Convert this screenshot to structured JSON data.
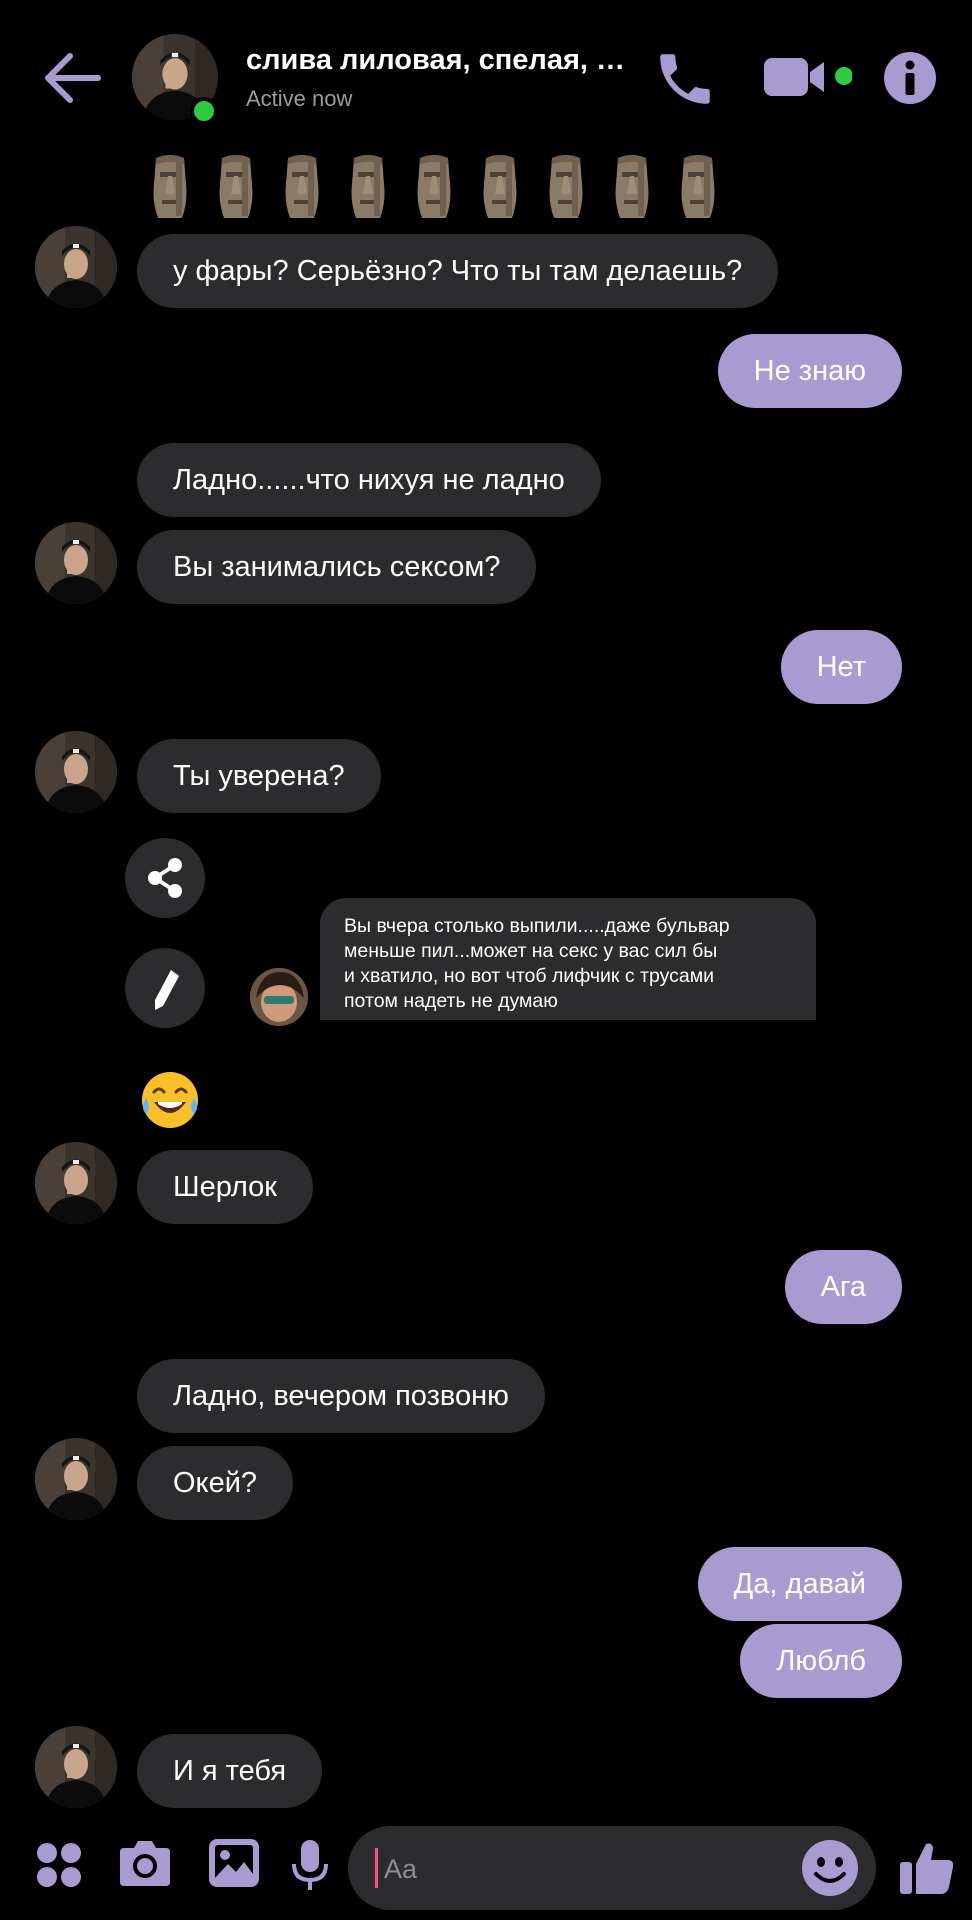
{
  "header": {
    "contact_name": "слива лиловая, спелая, с...",
    "status": "Active now"
  },
  "reaction_row": {
    "emoji": "moai",
    "count": 9
  },
  "messages": [
    {
      "side": "in",
      "text": "у фары? Серьёзно? Что ты там делаешь?"
    },
    {
      "side": "out",
      "text": "Не знаю"
    },
    {
      "side": "in",
      "text": "Ладно......что нихуя не ладно"
    },
    {
      "side": "in",
      "text": "Вы занимались сексом?"
    },
    {
      "side": "out",
      "text": "Нет"
    },
    {
      "side": "in",
      "text": "Ты уверена?"
    },
    {
      "side": "in",
      "text": "Шерлок"
    },
    {
      "side": "out",
      "text": "Ага"
    },
    {
      "side": "in",
      "text": "Ладно, вечером позвоню"
    },
    {
      "side": "in",
      "text": "Окей?"
    },
    {
      "side": "out",
      "text": "Да, давай"
    },
    {
      "side": "out",
      "text": "Люблб"
    },
    {
      "side": "in",
      "text": "И я тебя"
    }
  ],
  "shared_message": {
    "lines": [
      "Вы вчера столько выпили.....даже бульвар",
      "меньше пил...может на секс у вас сил бы",
      "и хватило, но вот чтоб лифчик с трусами",
      "потом надеть не думаю"
    ]
  },
  "composer": {
    "placeholder": "Aa"
  },
  "colors": {
    "accent": "#a79bd2",
    "incoming_bubble": "#2c2c2e",
    "online": "#2ecc40",
    "background": "#000000"
  },
  "icons": [
    "back-arrow-icon",
    "phone-icon",
    "video-camera-icon",
    "info-icon",
    "share-icon",
    "pencil-icon",
    "apps-icon",
    "camera-icon",
    "image-icon",
    "microphone-icon",
    "emoji-icon",
    "thumbs-up-icon"
  ]
}
